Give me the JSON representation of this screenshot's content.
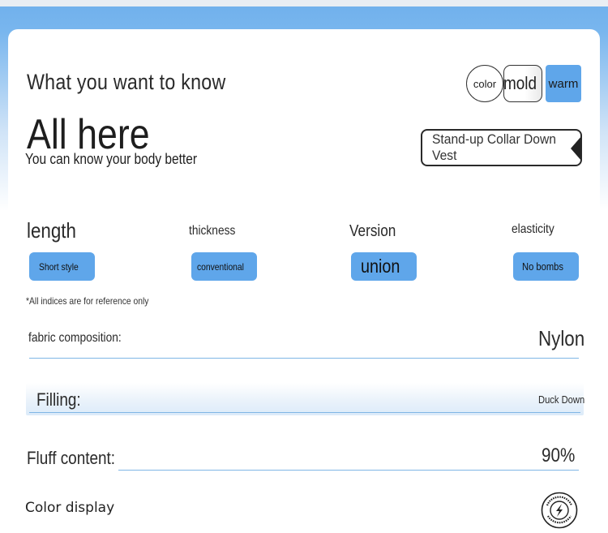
{
  "header": {
    "title_small": "What you want to know",
    "title_large": "All here",
    "subtitle": "You can know your body better"
  },
  "tags": {
    "color": "color",
    "mold": "mold",
    "warm": "warm"
  },
  "product": {
    "name": "Stand-up Collar Down Vest"
  },
  "attributes": [
    {
      "label": "length",
      "value": "Short style"
    },
    {
      "label": "thickness",
      "value": "conventional"
    },
    {
      "label": "Version",
      "value": "union"
    },
    {
      "label": "elasticity",
      "value": "No bombs"
    }
  ],
  "note": "*All indices are for reference only",
  "details": {
    "fabric_label": "fabric composition:",
    "fabric_value": "Nylon",
    "filling_label": "Filling:",
    "filling_value": "Duck Down",
    "fluff_label": "Fluff content:",
    "fluff_value": "90%"
  },
  "section": {
    "color_display": "Color display"
  },
  "colors": {
    "accent": "#5fa6ea",
    "line": "#7fb6e6",
    "header_blue": "#6fb0ec"
  }
}
